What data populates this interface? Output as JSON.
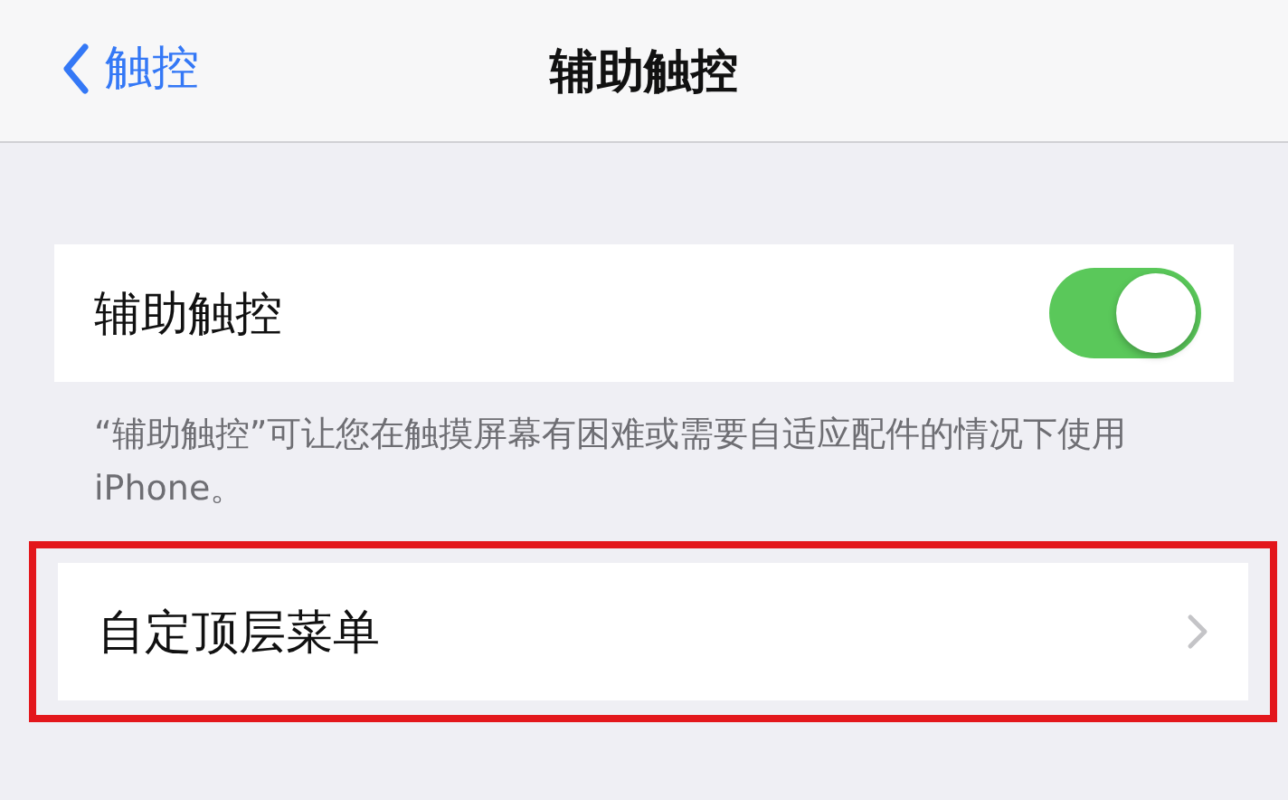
{
  "nav": {
    "back_label": "触控",
    "title": "辅助触控"
  },
  "toggle_row": {
    "label": "辅助触控",
    "on": true
  },
  "footer": "“辅助触控”可让您在触摸屏幕有困难或需要自适应配件的情况下使用iPhone。",
  "menu_row": {
    "label": "自定顶层菜单",
    "highlighted": true
  }
}
